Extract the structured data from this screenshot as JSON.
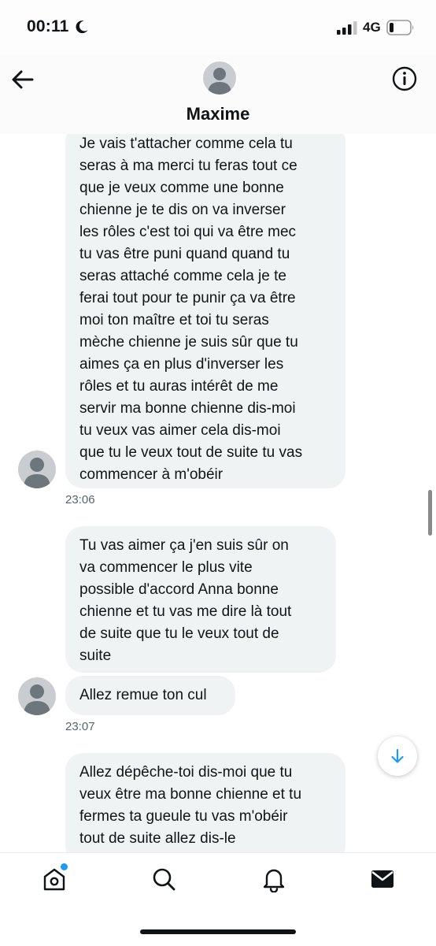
{
  "status_bar": {
    "time": "00:11",
    "network": "4G",
    "icons": [
      "moon-icon",
      "signal-icon",
      "battery-icon"
    ]
  },
  "header": {
    "contact_name": "Maxime",
    "icons": [
      "back-arrow-icon",
      "info-icon",
      "avatar-placeholder"
    ]
  },
  "messages": [
    {
      "id": 1,
      "text": "Je vais t'attacher comme cela tu\nseras à ma merci tu feras tout ce\nque je veux comme une bonne\nchienne je te dis on va inverser\nles rôles c'est toi qui va être mec\ntu vas être puni quand quand tu\nseras attaché comme cela je te\nferai tout pour te punir ça va être\nmoi ton maître et toi tu seras\nmèche chienne je suis sûr que tu\naimes ça en plus d'inverser les\nrôles et tu auras intérêt de me\nservir ma bonne chienne dis-moi\ntu veux vas aimer cela dis-moi\nque tu le veux tout de suite tu vas\ncommencer à m'obéir"
    },
    {
      "id": 2,
      "text": "Tu vas aimer ça j'en suis sûr on\nva commencer le plus vite\npossible d'accord Anna bonne\nchienne et tu vas me dire là tout\nde suite que tu le veux tout de\nsuite"
    },
    {
      "id": 3,
      "text": "Allez remue ton cul"
    },
    {
      "id": 4,
      "text": "Allez dépêche-toi dis-moi que tu\nveux être ma bonne chienne et tu\nfermes ta gueule tu vas m'obéir\ntout de suite allez dis-le"
    }
  ],
  "timestamps": [
    "23:06",
    "23:07"
  ],
  "tab_bar": {
    "tabs": [
      "home-icon",
      "search-icon",
      "notifications-icon",
      "messages-icon"
    ],
    "active_tab": "messages-icon",
    "accent_color": "#1d9bf0"
  },
  "colors": {
    "bubble_background": "#eff3f4",
    "text": "#0f1419",
    "secondary_text": "#536471",
    "accent": "#1d9bf0"
  }
}
